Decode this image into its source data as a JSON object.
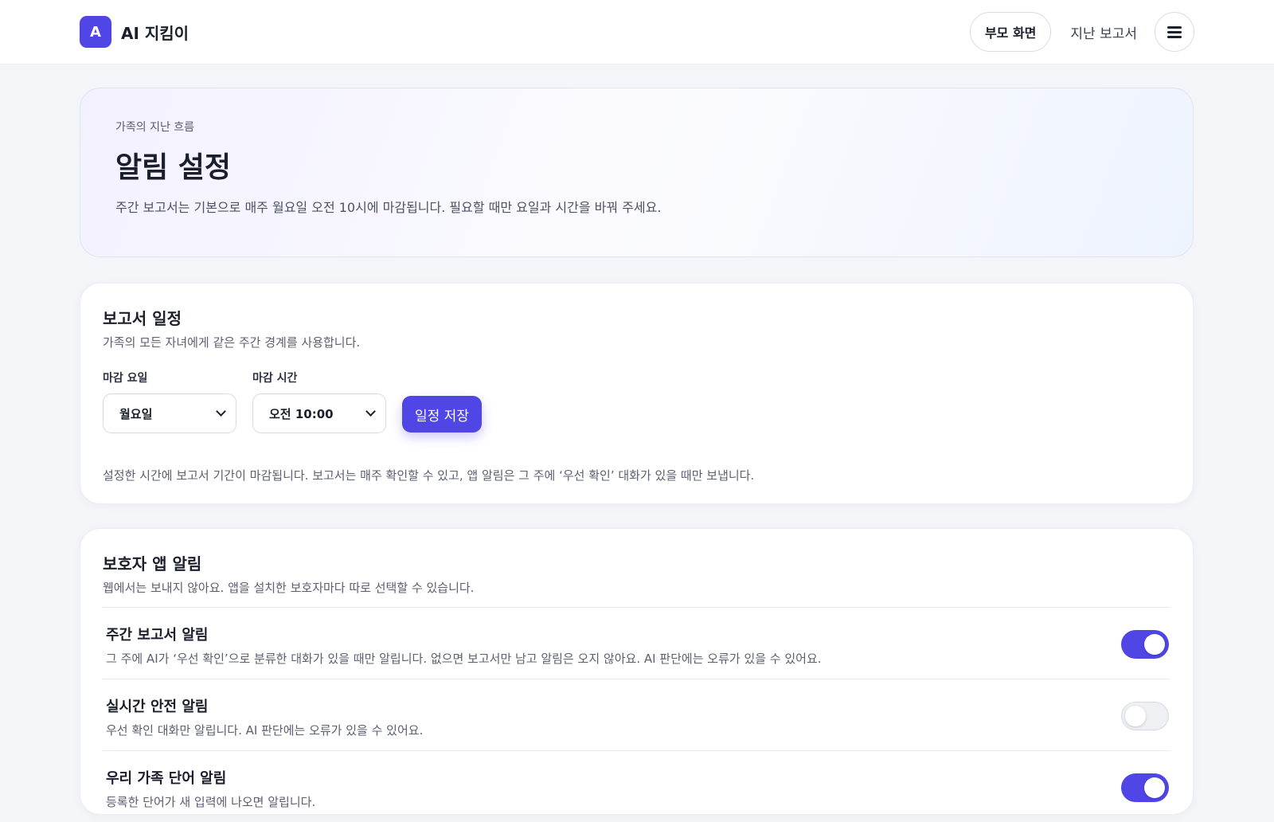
{
  "header": {
    "logo_letter": "A",
    "brand_name": "AI 지킴이",
    "nav_parent": "부모 화면",
    "nav_reports": "지난 보고서",
    "menu_icon": "hamburger-icon"
  },
  "hero": {
    "eyebrow": "가족의 지난 흐름",
    "title": "알림 설정",
    "description": "주간 보고서는 기본으로 매주 월요일 오전 10시에 마감됩니다. 필요할 때만 요일과 시간을 바꿔 주세요."
  },
  "schedule": {
    "title": "보고서 일정",
    "subtitle": "가족의 모든 자녀에게 같은 주간 경계를 사용합니다.",
    "day_label": "마감 요일",
    "day_value": "월요일",
    "time_label": "마감 시간",
    "time_value": "오전 10:00",
    "save_label": "일정 저장",
    "note": "설정한 시간에 보고서 기간이 마감됩니다. 보고서는 매주 확인할 수 있고, 앱 알림은 그 주에 ‘우선 확인’ 대화가 있을 때만 보냅니다."
  },
  "alerts": {
    "title": "보호자 앱 알림",
    "subtitle": "웹에서는 보내지 않아요. 앱을 설치한 보호자마다 따로 선택할 수 있습니다.",
    "items": [
      {
        "title": "주간 보고서 알림",
        "description": "그 주에 AI가 ‘우선 확인’으로 분류한 대화가 있을 때만 알립니다. 없으면 보고서만 남고 알림은 오지 않아요. AI 판단에는 오류가 있을 수 있어요.",
        "enabled": true
      },
      {
        "title": "실시간 안전 알림",
        "description": "우선 확인 대화만 알립니다. AI 판단에는 오류가 있을 수 있어요.",
        "enabled": false
      },
      {
        "title": "우리 가족 단어 알림",
        "description": "등록한 단어가 새 입력에 나오면 알립니다.",
        "enabled": true
      }
    ]
  },
  "colors": {
    "accent": "#4f46e5",
    "background": "#f4f5f9"
  }
}
